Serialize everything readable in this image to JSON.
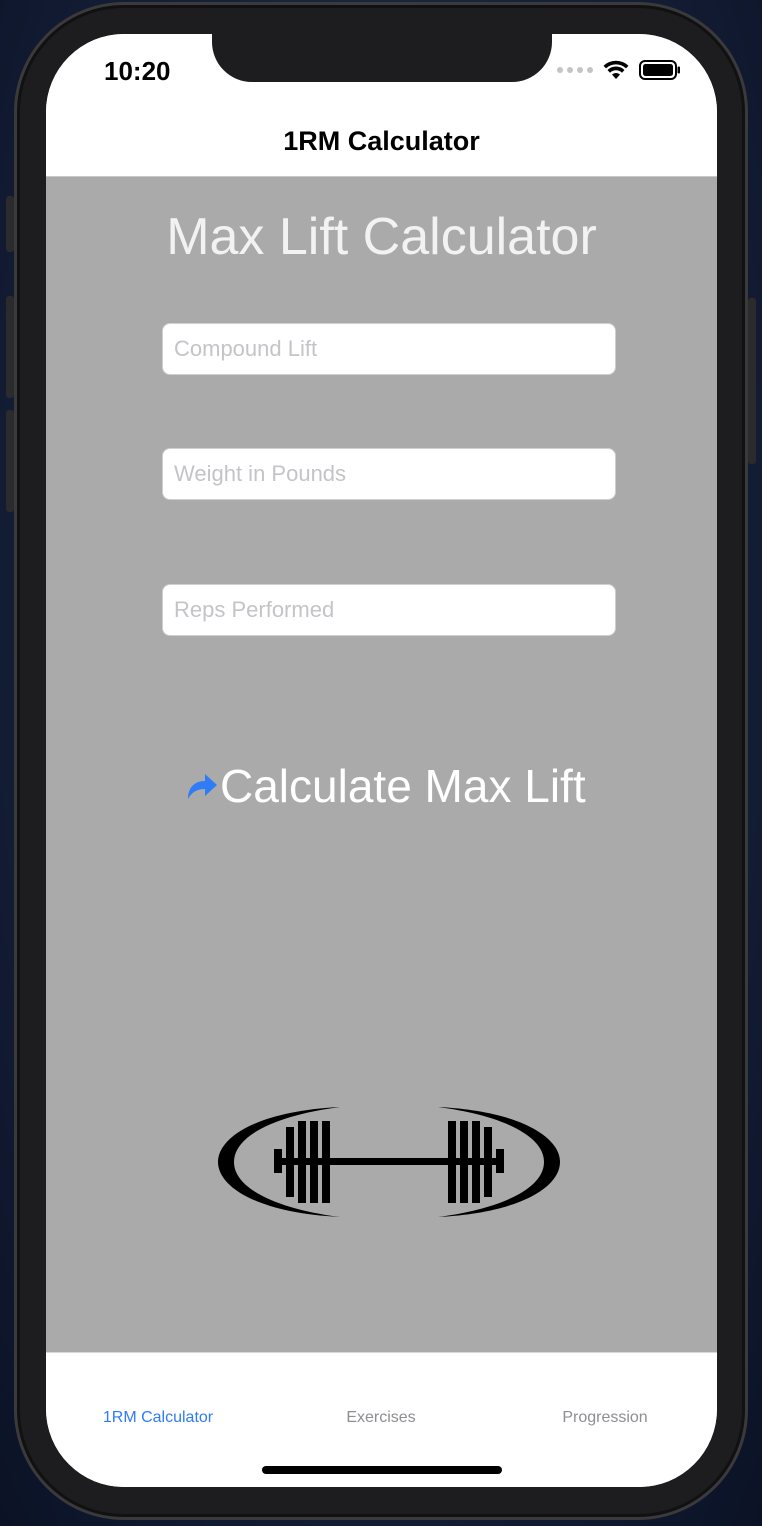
{
  "status_bar": {
    "time": "10:20"
  },
  "nav": {
    "title": "1RM Calculator"
  },
  "main": {
    "heading": "Max Lift Calculator",
    "fields": {
      "compound_lift": {
        "value": "",
        "placeholder": "Compound Lift"
      },
      "weight": {
        "value": "",
        "placeholder": "Weight in Pounds"
      },
      "reps": {
        "value": "",
        "placeholder": "Reps Performed"
      }
    },
    "calculate_label": "Calculate Max Lift",
    "calculate_icon": "share-arrow-icon",
    "logo_icon": "barbell-logo-icon"
  },
  "tab_bar": {
    "tabs": [
      {
        "label": "1RM Calculator",
        "active": true
      },
      {
        "label": "Exercises",
        "active": false
      },
      {
        "label": "Progression",
        "active": false
      }
    ]
  },
  "colors": {
    "accent": "#2f7cf6",
    "content_background": "#aaaaaa",
    "heading_text": "#f2f2f2",
    "inactive_tab": "#8e8e93"
  }
}
